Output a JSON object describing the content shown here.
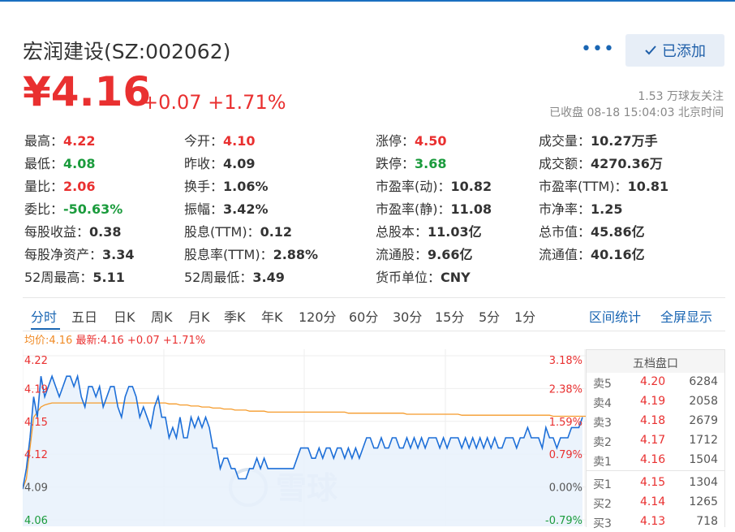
{
  "header": {
    "title": "宏润建设(SZ:002062)",
    "more": "•••",
    "added_button": "已添加",
    "price": "¥4.16",
    "change": "+0.07 +1.71%",
    "followers": "1.53 万球友关注",
    "status": "已收盘 08-18 15:04:03 北京时间"
  },
  "stats": [
    {
      "label": "最高：",
      "value": "4.22",
      "color": "red"
    },
    {
      "label": "今开：",
      "value": "4.10",
      "color": "red"
    },
    {
      "label": "涨停：",
      "value": "4.50",
      "color": "red"
    },
    {
      "label": "成交量：",
      "value": "10.27万手",
      "color": "dark"
    },
    {
      "label": "最低：",
      "value": "4.08",
      "color": "green"
    },
    {
      "label": "昨收：",
      "value": "4.09",
      "color": "dark"
    },
    {
      "label": "跌停：",
      "value": "3.68",
      "color": "green"
    },
    {
      "label": "成交额：",
      "value": "4270.36万",
      "color": "dark"
    },
    {
      "label": "量比：",
      "value": "2.06",
      "color": "red"
    },
    {
      "label": "换手：",
      "value": "1.06%",
      "color": "dark"
    },
    {
      "label": "市盈率(动)：",
      "value": "10.82",
      "color": "dark"
    },
    {
      "label": "市盈率(TTM)：",
      "value": "10.81",
      "color": "dark"
    },
    {
      "label": "委比：",
      "value": "-50.63%",
      "color": "green"
    },
    {
      "label": "振幅：",
      "value": "3.42%",
      "color": "dark"
    },
    {
      "label": "市盈率(静)：",
      "value": "11.08",
      "color": "dark"
    },
    {
      "label": "市净率：",
      "value": "1.25",
      "color": "dark"
    },
    {
      "label": "每股收益：",
      "value": "0.38",
      "color": "dark"
    },
    {
      "label": "股息(TTM)：",
      "value": "0.12",
      "color": "dark"
    },
    {
      "label": "总股本：",
      "value": "11.03亿",
      "color": "dark"
    },
    {
      "label": "总市值：",
      "value": "45.86亿",
      "color": "dark"
    },
    {
      "label": "每股净资产：",
      "value": "3.34",
      "color": "dark"
    },
    {
      "label": "股息率(TTM)：",
      "value": "2.88%",
      "color": "dark"
    },
    {
      "label": "流通股：",
      "value": "9.66亿",
      "color": "dark"
    },
    {
      "label": "流通值：",
      "value": "40.16亿",
      "color": "dark"
    },
    {
      "label": "52周最高：",
      "value": "5.11",
      "color": "dark"
    },
    {
      "label": "52周最低：",
      "value": "3.49",
      "color": "dark"
    },
    {
      "label": "货币单位：",
      "value": "CNY",
      "color": "dark"
    }
  ],
  "tabs": [
    "分时",
    "五日",
    "日K",
    "周K",
    "月K",
    "季K",
    "年K",
    "120分",
    "60分",
    "30分",
    "15分",
    "5分",
    "1分"
  ],
  "tab_links": [
    "区间统计",
    "全屏显示"
  ],
  "legend": {
    "avg": "均价:4.16",
    "latest": "最新:4.16 +0.07 +1.71%"
  },
  "watermark": "雪球",
  "chart_data": {
    "type": "line",
    "y_ticks_left": [
      "4.22",
      "4.19",
      "4.15",
      "4.12",
      "4.09",
      "4.06"
    ],
    "y_ticks_right": [
      "3.18%",
      "2.38%",
      "1.59%",
      "0.79%",
      "0.00%",
      "-0.79%"
    ],
    "ylim": [
      4.06,
      4.22
    ],
    "prev_close": 4.09,
    "series": [
      {
        "name": "最新",
        "color": "#1d6fd8",
        "values": [
          4.09,
          4.11,
          4.14,
          4.18,
          4.16,
          4.2,
          4.18,
          4.19,
          4.2,
          4.19,
          4.18,
          4.19,
          4.2,
          4.2,
          4.19,
          4.2,
          4.18,
          4.17,
          4.19,
          4.19,
          4.18,
          4.19,
          4.17,
          4.18,
          4.19,
          4.19,
          4.17,
          4.16,
          4.18,
          4.19,
          4.19,
          4.18,
          4.16,
          4.17,
          4.16,
          4.15,
          4.17,
          4.18,
          4.16,
          4.16,
          4.14,
          4.15,
          4.14,
          4.16,
          4.14,
          4.14,
          4.16,
          4.15,
          4.16,
          4.15,
          4.16,
          4.15,
          4.13,
          4.13,
          4.11,
          4.12,
          4.12,
          4.11,
          4.11,
          4.1,
          4.1,
          4.1,
          4.11,
          4.11,
          4.12,
          4.11,
          4.12,
          4.11,
          4.11,
          4.11,
          4.11,
          4.11,
          4.11,
          4.11,
          4.11,
          4.12,
          4.13,
          4.13,
          4.13,
          4.12,
          4.12,
          4.13,
          4.12,
          4.13,
          4.13,
          4.12,
          4.13,
          4.13,
          4.12,
          4.13,
          4.12,
          4.13,
          4.12,
          4.13,
          4.14,
          4.14,
          4.13,
          4.13,
          4.14,
          4.13,
          4.13,
          4.14,
          4.14,
          4.13,
          4.13,
          4.14,
          4.13,
          4.14,
          4.13,
          4.14,
          4.13,
          4.14,
          4.14,
          4.14,
          4.13,
          4.14,
          4.13,
          4.14,
          4.14,
          4.14,
          4.13,
          4.14,
          4.13,
          4.14,
          4.13,
          4.14,
          4.13,
          4.14,
          4.13,
          4.14,
          4.13,
          4.13,
          4.14,
          4.14,
          4.14,
          4.13,
          4.14,
          4.14,
          4.15,
          4.14,
          4.14,
          4.14,
          4.13,
          4.15,
          4.14,
          4.14,
          4.13,
          4.14,
          4.14,
          4.14,
          4.15,
          4.15,
          4.15,
          4.16
        ]
      },
      {
        "name": "均价",
        "color": "#f59b2b",
        "values": [
          4.09,
          4.1,
          4.13,
          4.16,
          4.165,
          4.17,
          4.172,
          4.173,
          4.174,
          4.174,
          4.174,
          4.174,
          4.174,
          4.174,
          4.174,
          4.174,
          4.174,
          4.174,
          4.174,
          4.174,
          4.174,
          4.174,
          4.174,
          4.174,
          4.174,
          4.174,
          4.174,
          4.174,
          4.174,
          4.174,
          4.174,
          4.174,
          4.174,
          4.174,
          4.174,
          4.174,
          4.174,
          4.174,
          4.174,
          4.174,
          4.173,
          4.173,
          4.173,
          4.172,
          4.172,
          4.172,
          4.171,
          4.171,
          4.171,
          4.17,
          4.17,
          4.17,
          4.169,
          4.169,
          4.169,
          4.168,
          4.168,
          4.168,
          4.167,
          4.167,
          4.167,
          4.167,
          4.166,
          4.166,
          4.166,
          4.166,
          4.166,
          4.165,
          4.165,
          4.165,
          4.165,
          4.165,
          4.165,
          4.165,
          4.165,
          4.165,
          4.165,
          4.165,
          4.165,
          4.165,
          4.165,
          4.165,
          4.165,
          4.165,
          4.165,
          4.165,
          4.165,
          4.165,
          4.165,
          4.164,
          4.164,
          4.164,
          4.164,
          4.164,
          4.164,
          4.164,
          4.164,
          4.164,
          4.164,
          4.164,
          4.164,
          4.164,
          4.164,
          4.164,
          4.164,
          4.163,
          4.163,
          4.163,
          4.163,
          4.163,
          4.163,
          4.163,
          4.163,
          4.163,
          4.163,
          4.163,
          4.163,
          4.163,
          4.163,
          4.163,
          4.162,
          4.162,
          4.162,
          4.162,
          4.162,
          4.162,
          4.162,
          4.162,
          4.162,
          4.162,
          4.162,
          4.162,
          4.162,
          4.162,
          4.162,
          4.162,
          4.162,
          4.162,
          4.162,
          4.162,
          4.162,
          4.162,
          4.162,
          4.162,
          4.162,
          4.161,
          4.161,
          4.161,
          4.161,
          4.161,
          4.161,
          4.161,
          4.161,
          4.161,
          4.161,
          4.16
        ]
      }
    ]
  },
  "order_book": {
    "title": "五档盘口",
    "asks": [
      {
        "label": "卖5",
        "price": "4.20",
        "volume": "6284"
      },
      {
        "label": "卖4",
        "price": "4.19",
        "volume": "2058"
      },
      {
        "label": "卖3",
        "price": "4.18",
        "volume": "2679"
      },
      {
        "label": "卖2",
        "price": "4.17",
        "volume": "1712"
      },
      {
        "label": "卖1",
        "price": "4.16",
        "volume": "1504"
      }
    ],
    "bids": [
      {
        "label": "买1",
        "price": "4.15",
        "volume": "1304"
      },
      {
        "label": "买2",
        "price": "4.14",
        "volume": "1265"
      },
      {
        "label": "买3",
        "price": "4.13",
        "volume": "718"
      }
    ]
  }
}
